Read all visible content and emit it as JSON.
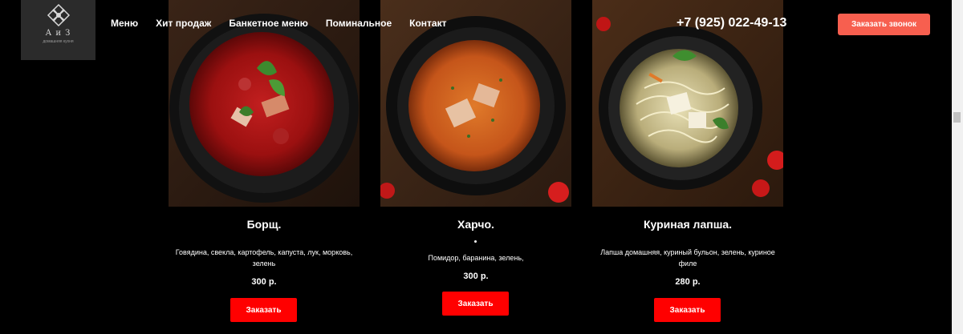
{
  "logo": {
    "name": "А и З",
    "subtitle": "домашняя кухня"
  },
  "nav": [
    {
      "label": "Меню"
    },
    {
      "label": "Хит продаж"
    },
    {
      "label": "Банкетное меню"
    },
    {
      "label": "Поминальное"
    },
    {
      "label": "Контакт"
    }
  ],
  "phone": "+7 (925) 022-49-13",
  "callback_label": "Заказать звонок",
  "products": [
    {
      "title": "Борщ.",
      "description": "Говядина, свекла, картофель, капуста, лук, морковь, зелень",
      "price": "300 р.",
      "button": "Заказать"
    },
    {
      "title": "Харчо.",
      "description": "Помидор, баранина, зелень,",
      "price": "300 р.",
      "button": "Заказать"
    },
    {
      "title": "Куриная лапша.",
      "description": "Лапша домашняя, куриный бульон, зелень, куриное филе",
      "price": "280 р.",
      "button": "Заказать"
    }
  ],
  "colors": {
    "accent": "#ff0000",
    "callback": "#f75f4f",
    "background": "#000000"
  }
}
